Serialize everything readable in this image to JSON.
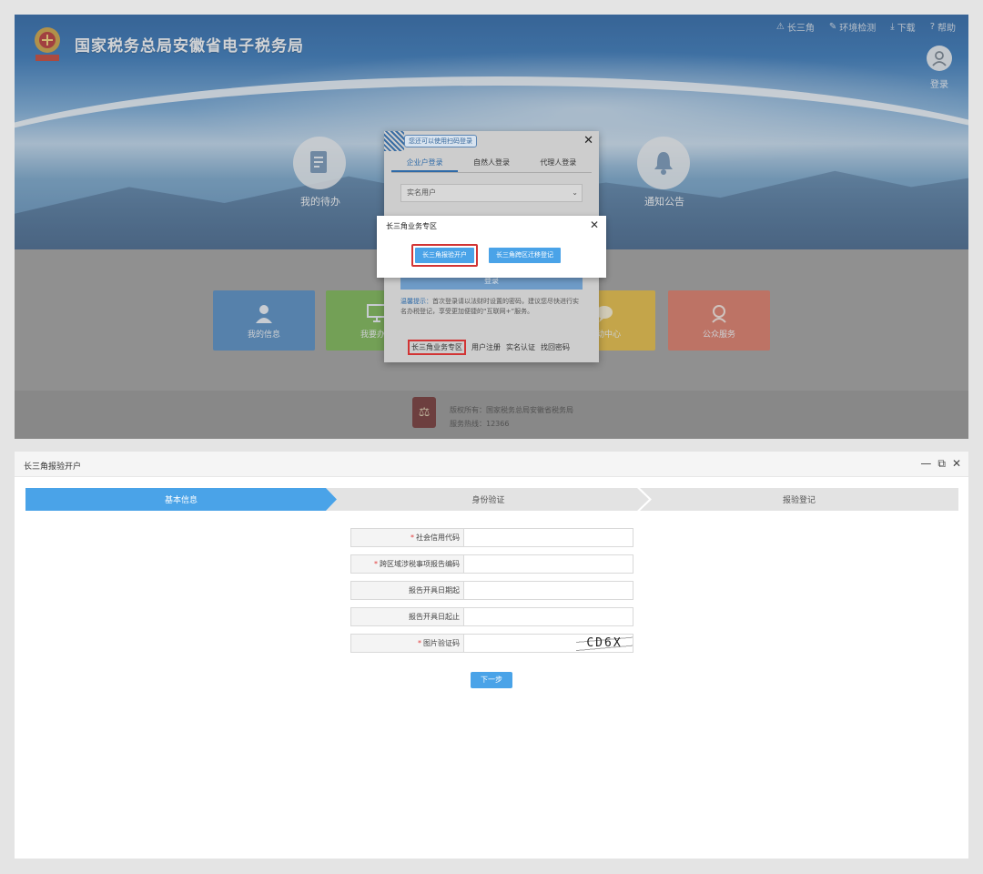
{
  "portal": {
    "site_title": "国家税务总局安徽省电子税务局",
    "nav_links": [
      {
        "label": "长三角",
        "icon": "triangle-icon"
      },
      {
        "label": "环境检测",
        "icon": "check-icon"
      },
      {
        "label": "下载",
        "icon": "download-icon"
      },
      {
        "label": "帮助",
        "icon": "help-icon"
      }
    ],
    "login_label": "登录",
    "hero_items": [
      {
        "label": "我的待办",
        "icon": "document-icon"
      },
      {
        "label": "通知公告",
        "icon": "bell-icon"
      }
    ],
    "tiles": [
      {
        "label": "我的信息",
        "color": "#4a86c0",
        "icon": "person-icon"
      },
      {
        "label": "我要办税",
        "color": "#72b04a",
        "icon": "monitor-icon"
      },
      {
        "label": "互动中心",
        "color": "#e2b83a",
        "icon": "chat-icon"
      },
      {
        "label": "公众服务",
        "color": "#d8725f",
        "icon": "service-icon"
      }
    ],
    "footer": {
      "copyright": "版权所有：国家税务总局安徽省税务局",
      "hotline": "服务热线：12366"
    }
  },
  "login_modal": {
    "qr_tip": "您还可以使用扫码登录",
    "tabs": [
      "企业户登录",
      "自然人登录",
      "代理人登录"
    ],
    "user_type": "实名用户",
    "login_button": "登录",
    "hint_label": "温馨提示：",
    "hint_text": "首次登录请以法财时设置的密码，建议您尽快进行实名办税登记，享受更加便捷的“互联网+”服务。",
    "links": [
      "长三角业务专区",
      "用户注册",
      "实名认证",
      "找回密码"
    ]
  },
  "yangtze_popup": {
    "title": "长三角业务专区",
    "button_primary": "长三角报验开户",
    "button_secondary": "长三角跨区迁移登记"
  },
  "form_window": {
    "title": "长三角报验开户",
    "controls": [
      "—",
      "⧉",
      "✕"
    ],
    "steps": [
      "基本信息",
      "身份验证",
      "报验登记"
    ],
    "fields": [
      {
        "label": "社会信用代码",
        "required": "*"
      },
      {
        "label": "跨区域涉税事项报告编码",
        "required": "*"
      },
      {
        "label": "报告开具日期起",
        "required": ""
      },
      {
        "label": "报告开具日起止",
        "required": ""
      },
      {
        "label": "图片验证码",
        "required": "*"
      }
    ],
    "captcha_text": "CD6X",
    "next_button": "下一步"
  }
}
